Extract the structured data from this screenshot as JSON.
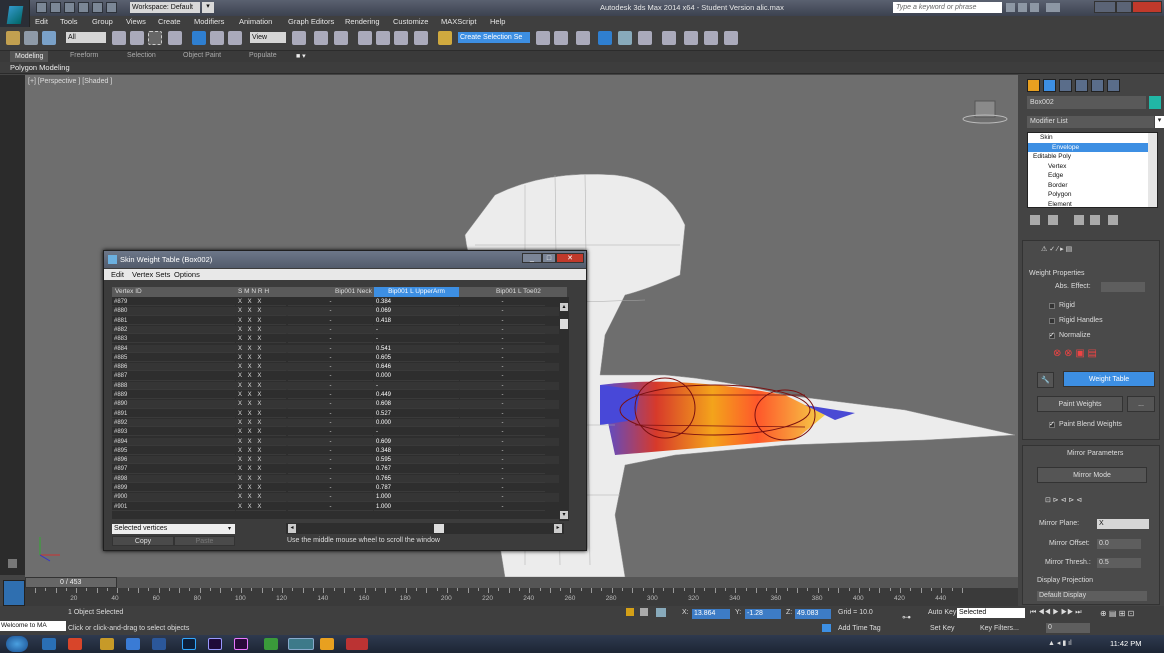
{
  "app": {
    "title": "Autodesk 3ds Max  2014 x64  -  Student Version    alic.max",
    "workspace": "Workspace: Default",
    "search_placeholder": "Type a keyword or phrase"
  },
  "menu": [
    "Edit",
    "Tools",
    "Group",
    "Views",
    "Create",
    "Modifiers",
    "Animation",
    "Graph Editors",
    "Rendering",
    "Customize",
    "MAXScript",
    "Help"
  ],
  "toolbar": {
    "filter": "All",
    "ref_coord": "View",
    "named_sel": "Create Selection Se"
  },
  "ribbon": {
    "tabs": [
      "Modeling",
      "Freeform",
      "Selection",
      "Object Paint",
      "Populate"
    ],
    "active": "Modeling",
    "sub": "Polygon Modeling"
  },
  "viewport": {
    "label": "[+] [Perspective ] [Shaded ]"
  },
  "command_panel": {
    "object_name": "Box002",
    "object_color": "#21b7a6",
    "modifier_list": "Modifier List",
    "stack": [
      {
        "label": "Skin",
        "selected": false
      },
      {
        "label": "Envelope",
        "selected": true
      },
      {
        "label": "Editable Poly",
        "selected": false
      },
      {
        "label": "Vertex",
        "selected": false
      },
      {
        "label": "Edge",
        "selected": false
      },
      {
        "label": "Border",
        "selected": false
      },
      {
        "label": "Polygon",
        "selected": false
      },
      {
        "label": "Element",
        "selected": false
      }
    ],
    "weight_properties": {
      "title": "Weight Properties",
      "abs_effect": "Abs. Effect:",
      "rigid": "Rigid",
      "rigid_handles": "Rigid Handles",
      "normalize": "Normalize",
      "weight_table": "Weight Table",
      "paint_weights": "Paint Weights",
      "dots": "...",
      "paint_blend": "Paint Blend Weights"
    },
    "mirror": {
      "title": "Mirror Parameters",
      "mode_btn": "Mirror Mode",
      "plane_label": "Mirror Plane:",
      "plane_value": "X",
      "offset_label": "Mirror Offset:",
      "offset_value": "0.0",
      "thresh_label": "Mirror Thresh.:",
      "thresh_value": "0.5",
      "display_projection": "Display Projection",
      "default_display": "Default Display"
    }
  },
  "dialog": {
    "title": "Skin Weight Table (Box002)",
    "menu": [
      "Edit",
      "Vertex Sets",
      "Options"
    ],
    "headers": {
      "vid": "Vertex ID",
      "smnrh": "S  M  N  R  H",
      "col1": "Bip001 Neck",
      "col2": "Bip001 L UpperArm",
      "col3": "Bip001 L Toe02"
    },
    "rows": [
      {
        "id": "#879",
        "flags": "X X X",
        "c1": "-",
        "c2": "0.384",
        "c3": "-"
      },
      {
        "id": "#880",
        "flags": "X X X",
        "c1": "-",
        "c2": "0.069",
        "c3": "-"
      },
      {
        "id": "#881",
        "flags": "X X X",
        "c1": "-",
        "c2": "0.418",
        "c3": "-"
      },
      {
        "id": "#882",
        "flags": "X X X",
        "c1": "-",
        "c2": "-",
        "c3": "-"
      },
      {
        "id": "#883",
        "flags": "X X X",
        "c1": "-",
        "c2": "-",
        "c3": "-"
      },
      {
        "id": "#884",
        "flags": "X X X",
        "c1": "-",
        "c2": "0.541",
        "c3": "-"
      },
      {
        "id": "#885",
        "flags": "X X X",
        "c1": "-",
        "c2": "0.605",
        "c3": "-"
      },
      {
        "id": "#886",
        "flags": "X X X",
        "c1": "-",
        "c2": "0.646",
        "c3": "-"
      },
      {
        "id": "#887",
        "flags": "X X X",
        "c1": "-",
        "c2": "0.000",
        "c3": "-"
      },
      {
        "id": "#888",
        "flags": "X X X",
        "c1": "-",
        "c2": "-",
        "c3": "-"
      },
      {
        "id": "#889",
        "flags": "X X X",
        "c1": "-",
        "c2": "0.449",
        "c3": "-"
      },
      {
        "id": "#890",
        "flags": "X X X",
        "c1": "-",
        "c2": "0.608",
        "c3": "-"
      },
      {
        "id": "#891",
        "flags": "X X X",
        "c1": "-",
        "c2": "0.527",
        "c3": "-"
      },
      {
        "id": "#892",
        "flags": "X X X",
        "c1": "-",
        "c2": "0.000",
        "c3": "-"
      },
      {
        "id": "#893",
        "flags": "X X X",
        "c1": "-",
        "c2": "-",
        "c3": "-"
      },
      {
        "id": "#894",
        "flags": "X X X",
        "c1": "-",
        "c2": "0.609",
        "c3": "-"
      },
      {
        "id": "#895",
        "flags": "X X X",
        "c1": "-",
        "c2": "0.348",
        "c3": "-"
      },
      {
        "id": "#896",
        "flags": "X X X",
        "c1": "-",
        "c2": "0.595",
        "c3": "-"
      },
      {
        "id": "#897",
        "flags": "X X X",
        "c1": "-",
        "c2": "0.767",
        "c3": "-"
      },
      {
        "id": "#898",
        "flags": "X X X",
        "c1": "-",
        "c2": "0.765",
        "c3": "-"
      },
      {
        "id": "#899",
        "flags": "X X X",
        "c1": "-",
        "c2": "0.787",
        "c3": "-"
      },
      {
        "id": "#900",
        "flags": "X X X",
        "c1": "-",
        "c2": "1.000",
        "c3": "-"
      },
      {
        "id": "#901",
        "flags": "X X X",
        "c1": "-",
        "c2": "1.000",
        "c3": "-"
      }
    ],
    "vertex_set": "Selected vertices",
    "copy": "Copy",
    "paste": "Paste",
    "hint": "Use the middle mouse wheel to scroll the window"
  },
  "timeline": {
    "frame": "0 / 453",
    "ticks": [
      "20",
      "40",
      "60",
      "80",
      "100",
      "120",
      "140",
      "160",
      "180",
      "200",
      "220",
      "240",
      "260",
      "280",
      "300",
      "320",
      "340",
      "360",
      "380",
      "400",
      "420",
      "440"
    ]
  },
  "status": {
    "objects": "1 Object Selected",
    "prompt": "Click or click-and-drag to select objects",
    "x": "13.864",
    "y": "-1.28",
    "z": "49.083",
    "grid": "Grid = 10.0",
    "add_time_tag": "Add Time Tag",
    "auto_key": "Auto Key",
    "key_mode": "Selected",
    "set_key": "Set Key",
    "key_filters": "Key Filters...",
    "frame_value": "0",
    "maxscript": "Welcome to MA"
  },
  "taskbar": {
    "clock": "11:42 PM"
  }
}
